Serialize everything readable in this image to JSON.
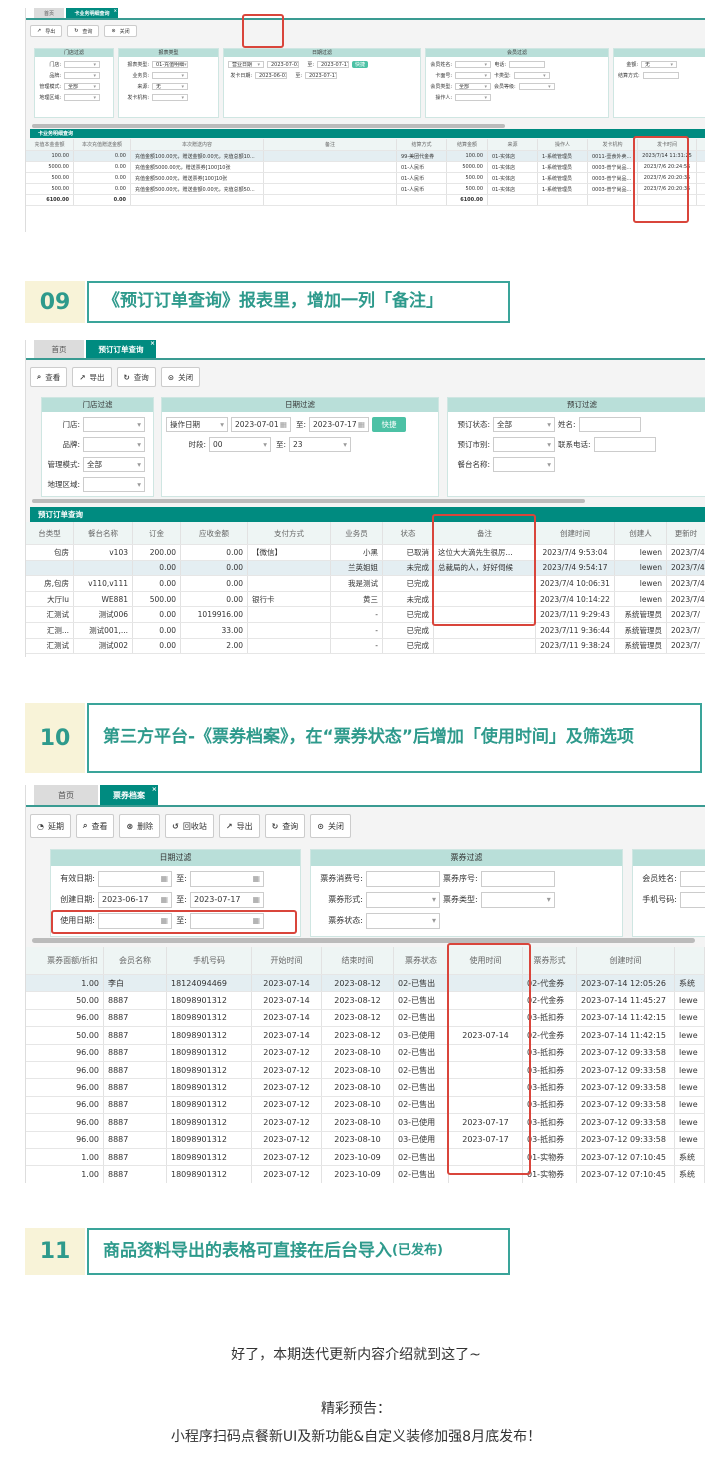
{
  "shot1": {
    "tabs": [
      "首页",
      "卡业务明细查询"
    ],
    "toolbar": [
      {
        "icon": "export-icon",
        "glyph": "↗",
        "label": "导出"
      },
      {
        "icon": "refresh-icon",
        "glyph": "↻",
        "label": "查询"
      },
      {
        "icon": "close-circle-icon",
        "glyph": "⊙",
        "label": "关闭"
      }
    ],
    "panels": [
      {
        "title": "门店过滤",
        "rows": [
          [
            {
              "label": "门店:",
              "value": "",
              "kind": "select"
            }
          ],
          [
            {
              "label": "品牌:",
              "value": "",
              "kind": "select"
            }
          ],
          [
            {
              "label": "管理模式:",
              "value": "全部",
              "kind": "select"
            }
          ],
          [
            {
              "label": "地理区域:",
              "value": "",
              "kind": "select"
            }
          ]
        ]
      },
      {
        "title": "报表类型",
        "rows": [
          [
            {
              "label": "报表类型:",
              "value": "01-充值明细",
              "kind": "select"
            }
          ],
          [
            {
              "label": "业务员:",
              "value": "",
              "kind": "select"
            }
          ],
          [
            {
              "label": "来源:",
              "value": "无",
              "kind": "select"
            }
          ],
          [
            {
              "label": "发卡机构:",
              "value": "",
              "kind": "select"
            }
          ]
        ]
      },
      {
        "title": "日期过滤",
        "rows": [
          [
            {
              "label": "",
              "value": "营业日期",
              "kind": "select"
            },
            {
              "label": "",
              "value": "2023-07-01",
              "kind": "date"
            },
            {
              "label": "至:",
              "value": "2023-07-17",
              "kind": "date"
            },
            {
              "label": "",
              "value": "快捷",
              "kind": "button"
            }
          ],
          [
            {
              "label": "发卡日期:",
              "value": "2023-06-01",
              "kind": "date"
            },
            {
              "label": "至:",
              "value": "2023-07-17",
              "kind": "date"
            }
          ]
        ]
      },
      {
        "title": "会员过滤",
        "rows": [
          [
            {
              "label": "会员姓名:",
              "value": "",
              "kind": "select"
            },
            {
              "label": "电话:",
              "value": "",
              "kind": "text"
            }
          ],
          [
            {
              "label": "卡面号:",
              "value": "",
              "kind": "select"
            },
            {
              "label": "卡类型:",
              "value": "",
              "kind": "select"
            }
          ],
          [
            {
              "label": "会员类型:",
              "value": "全部",
              "kind": "select"
            },
            {
              "label": "会员等级:",
              "value": "",
              "kind": "select"
            }
          ],
          [
            {
              "label": "操作人:",
              "value": "",
              "kind": "select"
            }
          ]
        ]
      },
      {
        "title": "",
        "rows": [
          [
            {
              "label": "金额:",
              "value": "无",
              "kind": "select"
            }
          ],
          [
            {
              "label": "结算方式:",
              "value": "",
              "kind": "text"
            }
          ]
        ]
      }
    ],
    "table": {
      "title": "卡业务明细查询",
      "columns": [
        "充值本金金额",
        "本次充值赠送金额",
        "本次赠送内容",
        "备注",
        "结算方式",
        "结算金额",
        "来源",
        "操作人",
        "发卡机构",
        "发卡时间"
      ],
      "rows": [
        [
          "100.00",
          "0.00",
          "充值金额100.00元，赠送金额0.00元，充值总额10...",
          "",
          "99-美团代金券",
          "100.00",
          "01-实体店",
          "1-系统管理员",
          "0011-壹食外卖...",
          "2023/7/14 11:31:25"
        ],
        [
          "5000.00",
          "0.00",
          "充值金额5000.00元，赠送票券[100]10张",
          "",
          "01-人民币",
          "5000.00",
          "01-实体店",
          "1-系统管理员",
          "0003-普宁尚品...",
          "2023/7/6 20:24:56"
        ],
        [
          "500.00",
          "0.00",
          "充值金额500.00元，赠送票券[100]10张",
          "",
          "01-人民币",
          "500.00",
          "01-实体店",
          "1-系统管理员",
          "0003-普宁尚品...",
          "2023/7/6 20:20:35"
        ],
        [
          "500.00",
          "0.00",
          "充值金额500.00元，赠送金额0.00元，充值总额50...",
          "",
          "01-人民币",
          "500.00",
          "01-实体店",
          "1-系统管理员",
          "0003-普宁尚品...",
          "2023/7/6 20:20:35"
        ]
      ],
      "totals": [
        "6100.00",
        "0.00",
        "",
        "",
        "",
        "6100.00",
        "",
        "",
        "",
        ""
      ]
    }
  },
  "section09": {
    "number": "09",
    "title": "《预订订单查询》报表里，增加一列「备注」"
  },
  "shot2": {
    "tabs": [
      "首页",
      "预订订单查询"
    ],
    "toolbar": [
      {
        "icon": "view-icon",
        "glyph": "⌕",
        "label": "查看"
      },
      {
        "icon": "export-icon",
        "glyph": "↗",
        "label": "导出"
      },
      {
        "icon": "refresh-icon",
        "glyph": "↻",
        "label": "查询"
      },
      {
        "icon": "close-circle-icon",
        "glyph": "⊙",
        "label": "关闭"
      }
    ],
    "panels": [
      {
        "title": "门店过滤",
        "rows": [
          [
            {
              "label": "门店:",
              "value": "",
              "kind": "select"
            }
          ],
          [
            {
              "label": "品牌:",
              "value": "",
              "kind": "select"
            }
          ],
          [
            {
              "label": "管理模式:",
              "value": "全部",
              "kind": "select"
            }
          ],
          [
            {
              "label": "地理区域:",
              "value": "",
              "kind": "select"
            }
          ]
        ]
      },
      {
        "title": "日期过滤",
        "rows": [
          [
            {
              "label": "",
              "value": "操作日期",
              "kind": "select"
            },
            {
              "label": "",
              "value": "2023-07-01",
              "kind": "date"
            },
            {
              "label": "至:",
              "value": "2023-07-17",
              "kind": "date"
            },
            {
              "label": "",
              "value": "快捷",
              "kind": "button"
            }
          ],
          [
            {
              "label": "时段:",
              "value": "00",
              "kind": "select"
            },
            {
              "label": "至:",
              "value": "23",
              "kind": "select"
            }
          ]
        ]
      },
      {
        "title": "预订过滤",
        "rows": [
          [
            {
              "label": "预订状态:",
              "value": "全部",
              "kind": "select"
            },
            {
              "label": "姓名:",
              "value": "",
              "kind": "text"
            }
          ],
          [
            {
              "label": "预订市别:",
              "value": "",
              "kind": "select"
            },
            {
              "label": "联系电话:",
              "value": "",
              "kind": "text"
            }
          ],
          [
            {
              "label": "餐台名称:",
              "value": "",
              "kind": "select"
            }
          ]
        ]
      }
    ],
    "table": {
      "title": "预订订单查询",
      "columns": [
        "台类型",
        "餐台名称",
        "订金",
        "应收金额",
        "支付方式",
        "业务员",
        "状态",
        "备注",
        "创建时间",
        "创建人",
        "更新时"
      ],
      "rows": [
        [
          "包房",
          "v103",
          "200.00",
          "0.00",
          "【微信】",
          "小黑",
          "已取消",
          "这位大大滴先生很厉...",
          "2023/7/4 9:53:04",
          "lewen",
          "2023/7/4"
        ],
        [
          "",
          "",
          "0.00",
          "0.00",
          "",
          "兰英姐姐",
          "未完成",
          "总裁局的人，好好伺候",
          "2023/7/4 9:54:17",
          "lewen",
          "2023/7/4"
        ],
        [
          "房,包房",
          "v110,v111",
          "0.00",
          "0.00",
          "",
          "我是测试",
          "已完成",
          "",
          "2023/7/4 10:06:31",
          "lewen",
          "2023/7/4"
        ],
        [
          "大厅lu",
          "WE881",
          "500.00",
          "0.00",
          "银行卡",
          "黄三",
          "未完成",
          "",
          "2023/7/4 10:14:22",
          "lewen",
          "2023/7/4"
        ],
        [
          "汇测试",
          "测试006",
          "0.00",
          "1019916.00",
          "",
          "-",
          "已完成",
          "",
          "2023/7/11 9:29:43",
          "系统管理员",
          "2023/7/"
        ],
        [
          "汇测...",
          "测试001,...",
          "0.00",
          "33.00",
          "",
          "-",
          "已完成",
          "",
          "2023/7/11 9:36:44",
          "系统管理员",
          "2023/7/"
        ],
        [
          "汇测试",
          "测试002",
          "0.00",
          "2.00",
          "",
          "-",
          "已完成",
          "",
          "2023/7/11 9:38:24",
          "系统管理员",
          "2023/7/"
        ]
      ]
    }
  },
  "section10": {
    "number": "10",
    "title": "第三方平台-《票券档案》，在“票券状态”后增加「使用时间」及筛选项"
  },
  "shot3": {
    "tabs": [
      "首页",
      "票券档案"
    ],
    "toolbar": [
      {
        "icon": "extend-icon",
        "glyph": "◔",
        "label": "延期"
      },
      {
        "icon": "view-icon",
        "glyph": "⌕",
        "label": "查看"
      },
      {
        "icon": "delete-icon",
        "glyph": "⊗",
        "label": "删除"
      },
      {
        "icon": "recycle-icon",
        "glyph": "↺",
        "label": "回收站"
      },
      {
        "icon": "export-icon",
        "glyph": "↗",
        "label": "导出"
      },
      {
        "icon": "refresh-icon",
        "glyph": "↻",
        "label": "查询"
      },
      {
        "icon": "close-circle-icon",
        "glyph": "⊙",
        "label": "关闭"
      }
    ],
    "panels": [
      {
        "title": "日期过滤",
        "rows": [
          [
            {
              "label": "有效日期:",
              "value": "",
              "kind": "date"
            },
            {
              "label": "至:",
              "value": "",
              "kind": "date"
            }
          ],
          [
            {
              "label": "创建日期:",
              "value": "2023-06-17",
              "kind": "date"
            },
            {
              "label": "至:",
              "value": "2023-07-17",
              "kind": "date"
            }
          ],
          [
            {
              "label": "使用日期:",
              "value": "",
              "kind": "date"
            },
            {
              "label": "至:",
              "value": "",
              "kind": "date"
            }
          ]
        ]
      },
      {
        "title": "票券过滤",
        "rows": [
          [
            {
              "label": "票券消费号:",
              "value": "",
              "kind": "text"
            },
            {
              "label": "票券序号:",
              "value": "",
              "kind": "text"
            }
          ],
          [
            {
              "label": "票券形式:",
              "value": "",
              "kind": "select"
            },
            {
              "label": "票券类型:",
              "value": "",
              "kind": "select"
            }
          ],
          [
            {
              "label": "票券状态:",
              "value": "",
              "kind": "select"
            }
          ]
        ]
      },
      {
        "title": "",
        "rows": [
          [
            {
              "label": "会员姓名:",
              "value": "",
              "kind": "text"
            }
          ],
          [
            {
              "label": "手机号码:",
              "value": "",
              "kind": "text"
            }
          ]
        ]
      }
    ],
    "table": {
      "columns": [
        "票券面额/折扣",
        "会员名称",
        "手机号码",
        "开始时间",
        "结束时间",
        "票券状态",
        "使用时间",
        "票券形式",
        "创建时间",
        ""
      ],
      "rows": [
        [
          "1.00",
          "李白",
          "18124094469",
          "2023-07-14",
          "2023-08-12",
          "02-已售出",
          "",
          "02-代金券",
          "2023-07-14 12:05:26",
          "系统"
        ],
        [
          "50.00",
          "8887",
          "18098901312",
          "2023-07-14",
          "2023-08-12",
          "02-已售出",
          "",
          "02-代金券",
          "2023-07-14 11:45:27",
          "lewe"
        ],
        [
          "96.00",
          "8887",
          "18098901312",
          "2023-07-14",
          "2023-08-12",
          "02-已售出",
          "",
          "03-抵扣券",
          "2023-07-14 11:42:15",
          "lewe"
        ],
        [
          "50.00",
          "8887",
          "18098901312",
          "2023-07-14",
          "2023-08-12",
          "03-已使用",
          "2023-07-14",
          "02-代金券",
          "2023-07-14 11:42:15",
          "lewe"
        ],
        [
          "96.00",
          "8887",
          "18098901312",
          "2023-07-12",
          "2023-08-10",
          "02-已售出",
          "",
          "03-抵扣券",
          "2023-07-12 09:33:58",
          "lewe"
        ],
        [
          "96.00",
          "8887",
          "18098901312",
          "2023-07-12",
          "2023-08-10",
          "02-已售出",
          "",
          "03-抵扣券",
          "2023-07-12 09:33:58",
          "lewe"
        ],
        [
          "96.00",
          "8887",
          "18098901312",
          "2023-07-12",
          "2023-08-10",
          "02-已售出",
          "",
          "03-抵扣券",
          "2023-07-12 09:33:58",
          "lewe"
        ],
        [
          "96.00",
          "8887",
          "18098901312",
          "2023-07-12",
          "2023-08-10",
          "02-已售出",
          "",
          "03-抵扣券",
          "2023-07-12 09:33:58",
          "lewe"
        ],
        [
          "96.00",
          "8887",
          "18098901312",
          "2023-07-12",
          "2023-08-10",
          "03-已使用",
          "2023-07-17",
          "03-抵扣券",
          "2023-07-12 09:33:58",
          "lewe"
        ],
        [
          "96.00",
          "8887",
          "18098901312",
          "2023-07-12",
          "2023-08-10",
          "03-已使用",
          "2023-07-17",
          "03-抵扣券",
          "2023-07-12 09:33:58",
          "lewe"
        ],
        [
          "1.00",
          "8887",
          "18098901312",
          "2023-07-12",
          "2023-10-09",
          "02-已售出",
          "",
          "01-实物券",
          "2023-07-12 07:10:45",
          "系统"
        ],
        [
          "1.00",
          "8887",
          "18098901312",
          "2023-07-12",
          "2023-10-09",
          "02-已售出",
          "",
          "01-实物券",
          "2023-07-12 07:10:45",
          "系统"
        ]
      ]
    }
  },
  "section11": {
    "number": "11",
    "title": "商品资料导出的表格可直接在后台导入",
    "note": "(已发布)"
  },
  "footer": {
    "line1": "好了，本期迭代更新内容介绍就到这了~",
    "line2": "精彩预告：",
    "line3": "小程序扫码点餐新UI及新功能&自定义装修加强8月底发布！"
  },
  "colors": {
    "teal": "#008b80",
    "highlight": "#d9453b",
    "section_text": "#2e9a8c",
    "number_bg": "#f8f3d8"
  }
}
